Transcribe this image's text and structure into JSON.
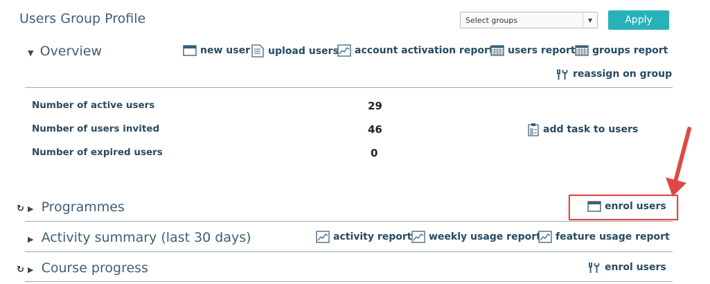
{
  "page_title": "Users Group Profile",
  "group_select": {
    "value": "Select groups"
  },
  "apply_label": "Apply",
  "overview": {
    "title": "Overview",
    "actions": {
      "new_user": "new user",
      "upload_users": "upload users",
      "account_activation_report": "account activation report",
      "users_report": "users report",
      "groups_report": "groups report",
      "reassign_on_group": "reassign on group"
    },
    "stats": [
      {
        "label": "Number of active users",
        "value": "29"
      },
      {
        "label": "Number of users invited",
        "value": "46"
      },
      {
        "label": "Number of expired users",
        "value": "0"
      }
    ],
    "add_task": "add task to users"
  },
  "programmes": {
    "title": "Programmes",
    "enrol_users": "enrol users"
  },
  "activity": {
    "title": "Activity summary (last 30 days)",
    "activity_report": "activity report",
    "weekly_usage_report": "weekly usage report",
    "feature_usage_report": "feature usage report"
  },
  "course_progress": {
    "title": "Course progress",
    "enrol_users": "enrol users"
  },
  "colors": {
    "accent": "#27b2b9",
    "annotation": "#e04848",
    "text": "#274a63"
  }
}
